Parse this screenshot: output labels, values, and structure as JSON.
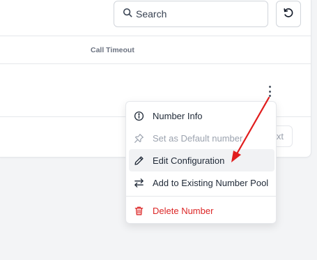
{
  "toolbar": {
    "search_placeholder": "Search",
    "refresh_icon": "refresh-icon"
  },
  "table": {
    "columns": [
      "Call Timeout"
    ]
  },
  "pagination": {
    "next_partial": "xt"
  },
  "menu": {
    "items": [
      {
        "label": "Number Info",
        "icon": "info-icon",
        "state": "normal"
      },
      {
        "label": "Set as Default number",
        "icon": "pin-icon",
        "state": "disabled"
      },
      {
        "label": "Edit Configuration",
        "icon": "pencil-icon",
        "state": "hovered"
      },
      {
        "label": "Add to Existing Number Pool",
        "icon": "swap-arrows-icon",
        "state": "normal"
      },
      {
        "label": "Delete Number",
        "icon": "trash-icon",
        "state": "danger"
      }
    ]
  },
  "colors": {
    "danger": "#dc2626",
    "annotation_arrow": "#e11d1d",
    "border": "#e5e7eb",
    "muted_text": "#9ca3af"
  }
}
